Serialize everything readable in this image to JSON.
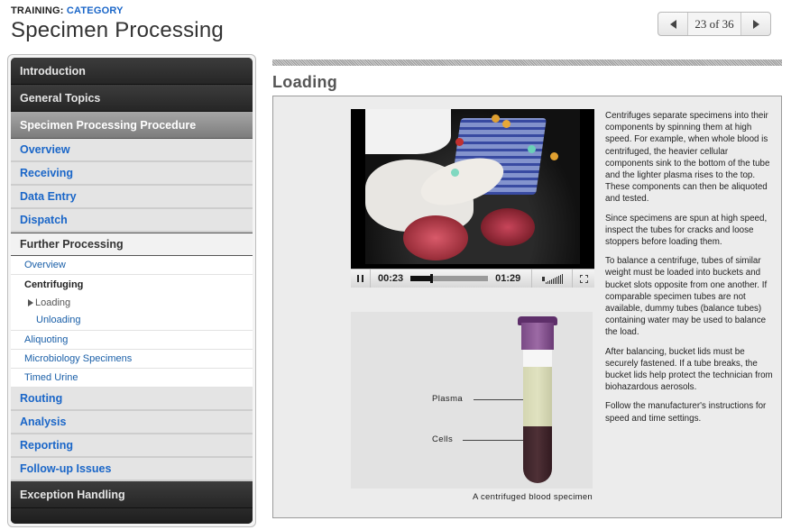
{
  "header": {
    "crumb_prefix": "TRAINING:",
    "crumb_category": "CATEGORY",
    "title": "Specimen Processing"
  },
  "pager": {
    "current": 23,
    "total": 36,
    "label": "23 of 36",
    "prev_icon": "triangle-left-icon",
    "next_icon": "triangle-right-icon"
  },
  "sidebar": {
    "top_items": [
      {
        "label": "Introduction"
      },
      {
        "label": "General Topics"
      }
    ],
    "active_section": "Specimen Processing Procedure",
    "sub_items_before": [
      {
        "label": "Overview"
      },
      {
        "label": "Receiving"
      },
      {
        "label": "Data Entry"
      },
      {
        "label": "Dispatch"
      }
    ],
    "open_sub": "Further Processing",
    "open_sub_children": {
      "overview": "Overview",
      "centrifuging": "Centrifuging",
      "centrifuging_children": [
        "Loading",
        "Unloading"
      ],
      "current_page": "Loading",
      "aliquoting": "Aliquoting",
      "microbiology": "Microbiology Specimens",
      "timed_urine": "Timed Urine"
    },
    "sub_items_after": [
      {
        "label": "Routing"
      },
      {
        "label": "Analysis"
      },
      {
        "label": "Reporting"
      },
      {
        "label": "Follow-up Issues"
      }
    ],
    "bottom_items": [
      {
        "label": "Exception Handling"
      }
    ]
  },
  "main": {
    "section_title": "Loading",
    "video": {
      "elapsed": "00:23",
      "duration": "01:29",
      "progress_fraction": 0.26,
      "state": "playing",
      "pause_icon": "pause-icon",
      "volume_icon": "volume-icon",
      "fullscreen_icon": "fullscreen-icon"
    },
    "diagram": {
      "label_plasma": "Plasma",
      "label_cells": "Cells",
      "caption": "A centrifuged blood specimen"
    },
    "paragraphs": [
      "Centrifuges separate specimens into their components by spinning them at high speed. For example, when whole blood is centrifuged, the heavier cellular components sink to the bottom of the tube and the lighter plasma rises to the top. These components can then be aliquoted and tested.",
      "Since specimens are spun at high speed, inspect the tubes for cracks and loose stoppers before loading them.",
      "To balance a centrifuge, tubes of similar weight must be loaded into buckets and bucket slots opposite from one another. If comparable specimen tubes are not available, dummy tubes (balance tubes) containing water may be used to balance the load.",
      "After balancing, bucket lids must be securely fastened. If a tube breaks, the bucket lids help protect the technician from biohazardous aerosols.",
      "Follow the manufacturer's instructions for speed and time settings."
    ]
  },
  "colors": {
    "link_blue": "#1a66c8",
    "nav_dark": "#262626",
    "nav_active": "#8c8c8c",
    "tube_cap": "#7a4a85",
    "plasma": "#d8dab6",
    "cells": "#3e262c"
  }
}
